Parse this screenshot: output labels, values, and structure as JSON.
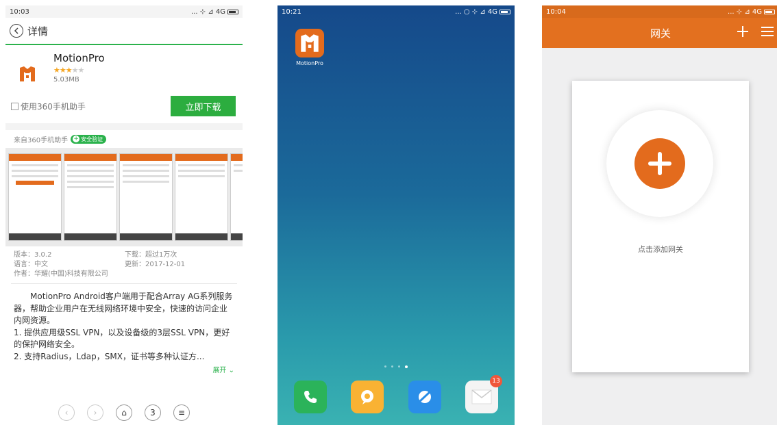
{
  "phone1": {
    "status": {
      "time": "10:03",
      "right": "... ⊹ ⊿ 4G"
    },
    "header": {
      "back_icon": "chevron-left-icon",
      "title": "详情"
    },
    "app": {
      "name": "MotionPro",
      "rating": 3.5,
      "stars_text": "★★★",
      "stars_dim": "★★",
      "size": "5.03MB"
    },
    "assistant_checkbox": "使用360手机助手",
    "download_button": "立即下载",
    "source": {
      "text": "来自360手机助手",
      "badge": "安全验证"
    },
    "meta": {
      "version": "版本：3.0.2",
      "downloads": "下载：超过1万次",
      "language": "语言：中文",
      "updated": "更新：2017-12-01",
      "author": "作者：华耀(中国)科技有限公司"
    },
    "description": [
      "MotionPro Android客户端用于配合Array AG系列服务器，帮助企业用户在无线网络环境中安全，快速的访问企业内网资源。",
      "1. 提供应用级SSL VPN，以及设备级的3层SSL VPN，更好的保护网络安全。",
      "2. 支持Radius，Ldap，SMX，证书等多种认证方..."
    ],
    "expand": "展开",
    "nav": {
      "back": "‹",
      "forward": "›",
      "home": "⌂",
      "tabs": "3",
      "menu": "≡"
    }
  },
  "phone2": {
    "status": {
      "time": "10:21",
      "right": "... ○ ⊹ ⊿ 4G"
    },
    "app_label": "MotionPro",
    "mail_badge": "13",
    "dock_icons": [
      "phone-icon",
      "message-icon",
      "browser-icon",
      "mail-icon"
    ],
    "colors": {
      "phone": "#2bb35a",
      "message": "#f9b233",
      "browser": "#2a8ee8",
      "mail": "#f4f4f4"
    }
  },
  "phone3": {
    "status": {
      "time": "10:04",
      "right": "... ⊹ ⊿ 4G"
    },
    "title": "网关",
    "add_hint": "点击添加网关",
    "accent": "#e36b1d"
  }
}
